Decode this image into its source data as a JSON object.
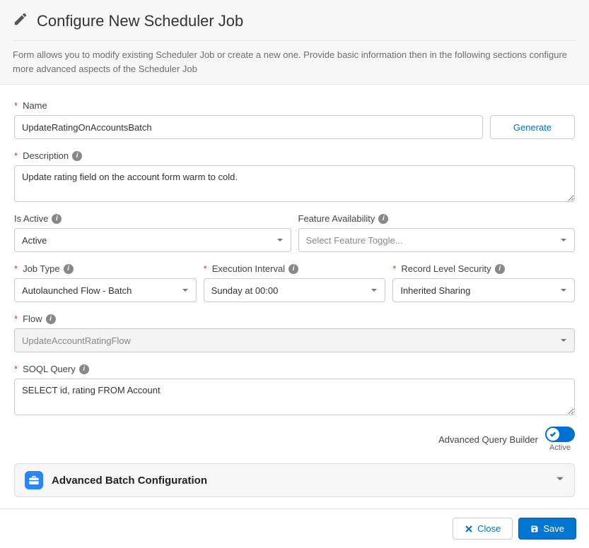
{
  "header": {
    "title": "Configure New Scheduler Job",
    "subtitle": "Form allows you to modify existing Scheduler Job or create a new one. Provide basic information then in the following sections configure more advanced aspects of the Scheduler Job"
  },
  "fields": {
    "name": {
      "label": "Name",
      "value": "UpdateRatingOnAccountsBatch"
    },
    "generate_btn": "Generate",
    "description": {
      "label": "Description",
      "value": "Update rating field on the account form warm to cold."
    },
    "is_active": {
      "label": "Is Active",
      "value": "Active"
    },
    "feature_availability": {
      "label": "Feature Availability",
      "placeholder": "Select Feature Toggle..."
    },
    "job_type": {
      "label": "Job Type",
      "value": "Autolaunched Flow - Batch"
    },
    "execution_interval": {
      "label": "Execution Interval",
      "value": "Sunday at 00:00"
    },
    "record_level_security": {
      "label": "Record Level Security",
      "value": "Inherited Sharing"
    },
    "flow": {
      "label": "Flow",
      "value": "UpdateAccountRatingFlow"
    },
    "soql": {
      "label": "SOQL Query",
      "value": "SELECT id, rating FROM Account"
    }
  },
  "query_builder": {
    "label": "Advanced Query Builder",
    "status": "Active"
  },
  "accordion": {
    "title": "Advanced Batch Configuration"
  },
  "footer": {
    "close": "Close",
    "save": "Save"
  }
}
